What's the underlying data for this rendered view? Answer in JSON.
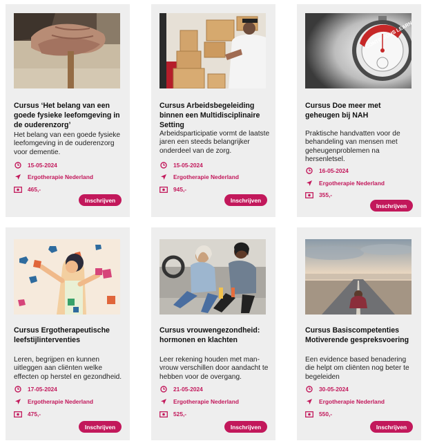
{
  "courses": [
    {
      "title": "Cursus ‘Het belang van een goede fysieke leefomgeving in de ouderenzorg’",
      "description": "Het belang van een goede fysieke leefomgeving in de ouderenzorg voor dementie.",
      "date": "15-05-2024",
      "location": "Ergotherapie Nederland",
      "price": "465,-",
      "button_label": "Inschrijven",
      "image": "elderly-hands-on-cane-photo"
    },
    {
      "title": "Cursus Arbeidsbegeleiding binnen een Multidisciplinaire Setting",
      "description": "Arbeidsparticipatie vormt de laatste jaren een steeds belangrijker onderdeel van de zorg.",
      "date": "15-05-2024",
      "location": "Ergotherapie Nederland",
      "price": "945,-",
      "button_label": "Inschrijven",
      "image": "worker-moving-boxes-photo"
    },
    {
      "title": "Cursus Doe meer met geheugen bij NAH",
      "description": "Praktische handvatten voor de behandeling van mensen met geheugenproblemen na hersenletsel.",
      "date": "16-05-2024",
      "location": "Ergotherapie Nederland",
      "price": "355,-",
      "button_label": "Inschrijven",
      "image": "continuous-learning-stopwatch-photo",
      "image_text": "CONTINUOUS LEARNING"
    },
    {
      "title": "Cursus Ergotherapeutische leefstijlinterventies",
      "description": "Leren, begrijpen en kunnen uitleggen aan cliënten welke effecten op herstel en gezondheid.",
      "date": "17-05-2024",
      "location": "Ergotherapie Nederland",
      "price": "475,-",
      "button_label": "Inschrijven",
      "image": "puzzle-pieces-illustration"
    },
    {
      "title": "Cursus vrouwengezondheid: hormonen en klachten",
      "description": "Leer rekening houden met man-vrouw verschillen door aandacht te hebben voor de overgang.",
      "date": "21-05-2024",
      "location": "Ergotherapie Nederland",
      "price": "525,-",
      "button_label": "Inschrijven",
      "image": "women-laughing-gym-photo"
    },
    {
      "title": "Cursus Basiscompetenties Motiverende gespreksvoering",
      "description": "Een evidence based benadering die helpt om cliënten nog beter te begeleiden",
      "date": "30-05-2024",
      "location": "Ergotherapie Nederland",
      "price": "550,-",
      "button_label": "Inschrijven",
      "image": "person-on-road-horizon-photo"
    }
  ],
  "colors": {
    "accent": "#c2185b",
    "card_bg": "#eeeeee"
  },
  "icons": {
    "date": "clock-icon",
    "location": "location-arrow-icon",
    "price": "money-icon"
  }
}
